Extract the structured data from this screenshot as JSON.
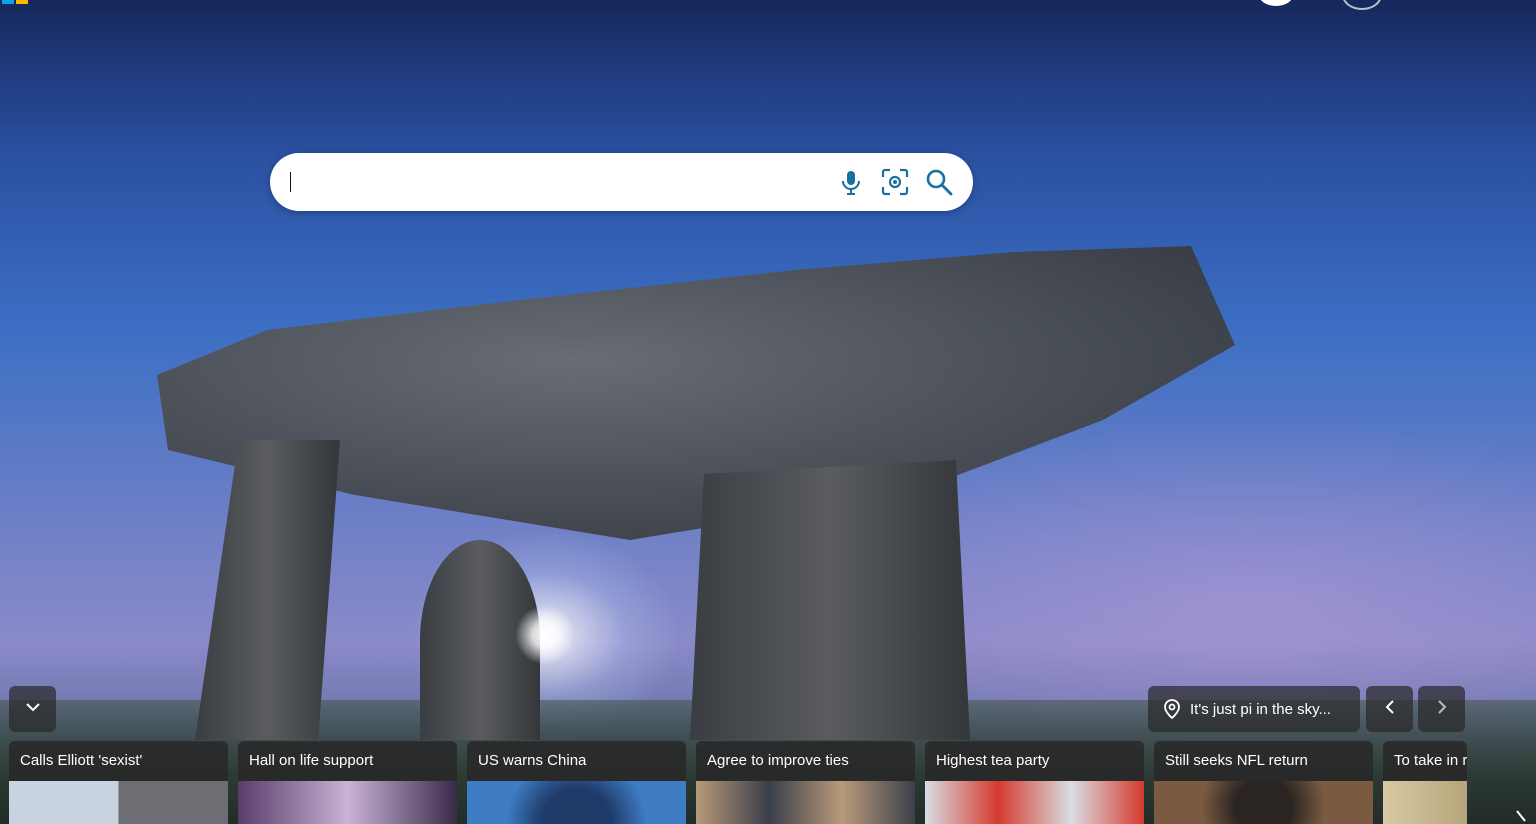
{
  "search": {
    "value": "",
    "placeholder": "",
    "mic_icon": "microphone-icon",
    "visual_icon": "visual-search-icon",
    "search_icon": "search-icon",
    "accent_color": "#1a6fa3"
  },
  "image_info": {
    "title": "It's just pi in the sky...",
    "icon": "location-pin-icon"
  },
  "controls": {
    "collapse_icon": "chevron-down-icon",
    "prev_icon": "chevron-left-icon",
    "next_icon": "chevron-right-icon"
  },
  "news": [
    {
      "headline": "Calls Elliott 'sexist'",
      "thumb_colors": [
        "#c9d3e0",
        "#6d6e73"
      ]
    },
    {
      "headline": "Hall on life support",
      "thumb_colors": [
        "#5a3c6a",
        "#c9b3d6"
      ]
    },
    {
      "headline": "US warns China",
      "thumb_colors": [
        "#3e7cc4",
        "#1f3b6a"
      ]
    },
    {
      "headline": "Agree to improve ties",
      "thumb_colors": [
        "#b89a7a",
        "#3a3f4a"
      ]
    },
    {
      "headline": "Highest tea party",
      "thumb_colors": [
        "#d63a2e",
        "#d9dde3"
      ]
    },
    {
      "headline": "Still seeks NFL return",
      "thumb_colors": [
        "#7a5a40",
        "#2a2522"
      ]
    },
    {
      "headline": "To take in r",
      "thumb_colors": [
        "#d8c9a4",
        "#b7a47a"
      ]
    }
  ]
}
